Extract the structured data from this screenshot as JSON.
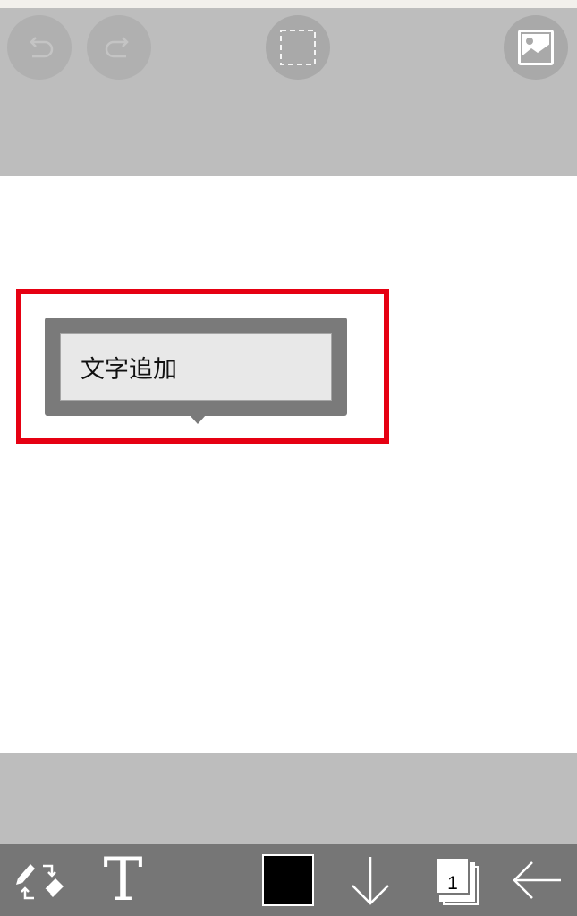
{
  "top_bar": {
    "undo_icon": "undo-arrow-icon",
    "redo_icon": "redo-arrow-icon",
    "select_icon": "dashed-selection-icon",
    "image_icon": "image-picture-icon"
  },
  "popup_menu": {
    "items": [
      {
        "label": "文字追加"
      }
    ]
  },
  "toolbar": {
    "pen_eraser_icon": "pen-eraser-swap-icon",
    "text_tool_label": "T",
    "color": "#000000",
    "down_icon": "arrow-down-icon",
    "layer_count": "1",
    "back_icon": "arrow-left-icon"
  },
  "colors": {
    "highlight": "#e60012",
    "panel_gray": "#bdbdbd",
    "toolbar_gray": "#767676",
    "popup_gray": "#7a7a7a"
  }
}
